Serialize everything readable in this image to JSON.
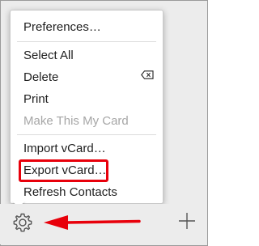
{
  "menu": {
    "items": [
      {
        "label": "Preferences…",
        "enabled": true
      },
      {
        "label": "Select All",
        "enabled": true
      },
      {
        "label": "Delete",
        "enabled": true,
        "icon": "delete-key-icon"
      },
      {
        "label": "Print",
        "enabled": true
      },
      {
        "label": "Make This My Card",
        "enabled": false
      },
      {
        "label": "Import vCard…",
        "enabled": true
      },
      {
        "label": "Export vCard…",
        "enabled": true,
        "highlighted": true
      },
      {
        "label": "Refresh Contacts",
        "enabled": true
      }
    ]
  },
  "toolbar": {
    "left_icon": "gear-icon",
    "right_icon": "plus-icon"
  },
  "annotation": {
    "color": "#e8000b",
    "arrow_icon": "arrow-left-icon"
  }
}
